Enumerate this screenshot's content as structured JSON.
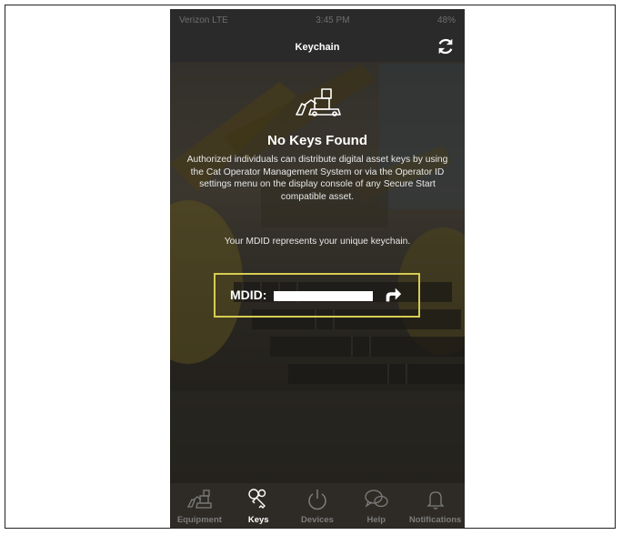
{
  "status_bar": {
    "carrier": "Verizon LTE",
    "time": "3:45 PM",
    "battery": "48%"
  },
  "nav": {
    "title": "Keychain",
    "refresh_icon": "refresh-icon"
  },
  "empty_state": {
    "icon": "equipment-icon",
    "title": "No Keys Found",
    "description": "Authorized individuals can distribute digital asset keys by using the Cat Operator Management System or via the Operator ID settings menu on the display console of any Secure Start compatible asset.",
    "mdid_note": "Your MDID represents your unique keychain."
  },
  "mdid": {
    "label": "MDID:",
    "value_redacted": true,
    "share_icon": "share-arrow-icon"
  },
  "tabs": [
    {
      "label": "Equipment",
      "icon": "equipment-icon",
      "active": false
    },
    {
      "label": "Keys",
      "icon": "keys-icon",
      "active": true
    },
    {
      "label": "Devices",
      "icon": "power-icon",
      "active": false
    },
    {
      "label": "Help",
      "icon": "chat-bubbles-icon",
      "active": false
    },
    {
      "label": "Notifications",
      "icon": "bell-icon",
      "active": false
    }
  ],
  "colors": {
    "highlight_border": "#d6cc52",
    "nav_background": "#2a2a2a",
    "tab_background": "#2e2b26"
  }
}
